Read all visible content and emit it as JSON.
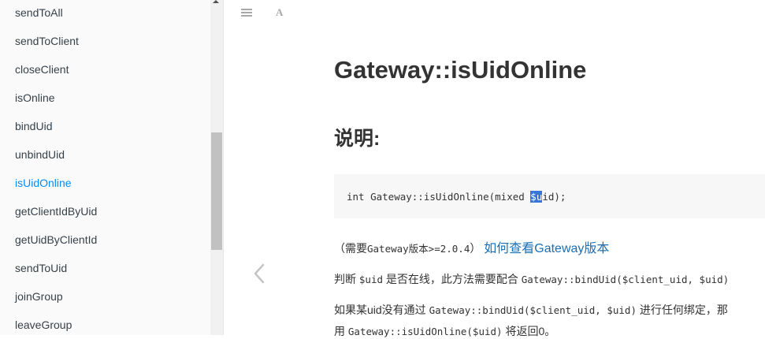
{
  "sidebar": {
    "items": [
      {
        "label": "sendToAll",
        "active": false
      },
      {
        "label": "sendToClient",
        "active": false
      },
      {
        "label": "closeClient",
        "active": false
      },
      {
        "label": "isOnline",
        "active": false
      },
      {
        "label": "bindUid",
        "active": false
      },
      {
        "label": "unbindUid",
        "active": false
      },
      {
        "label": "isUidOnline",
        "active": true
      },
      {
        "label": "getClientIdByUid",
        "active": false
      },
      {
        "label": "getUidByClientId",
        "active": false
      },
      {
        "label": "sendToUid",
        "active": false
      },
      {
        "label": "joinGroup",
        "active": false
      },
      {
        "label": "leaveGroup",
        "active": false
      }
    ]
  },
  "toolbar": {
    "menu_icon": "menu-icon",
    "font_icon": "font-settings-icon",
    "font_glyph": "A"
  },
  "nav": {
    "prev_icon": "chevron-left-icon"
  },
  "page": {
    "title": "Gateway::isUidOnline",
    "section_heading": "说明:",
    "code": {
      "before": "int Gateway::isUidOnline(mixed ",
      "selected": "$u",
      "after": "id);"
    },
    "version": {
      "prefix": "（需要",
      "code": "Gateway版本>=2.0.4",
      "suffix": "）",
      "link": "如何查看Gateway版本"
    },
    "para1": {
      "t1": "判断 ",
      "c1": "$uid",
      "t2": " 是否在线，此方法需要配合 ",
      "c2": "Gateway::bindUid($client_uid, $uid)"
    },
    "para2": {
      "t1": "如果某uid没有通过 ",
      "c1": "Gateway::bindUid($client_uid, $uid)",
      "t2": " 进行任何绑定，那"
    },
    "para3": {
      "t1": "用 ",
      "c1": "Gateway::isUidOnline($uid)",
      "t2": " 将返回0。"
    }
  },
  "colors": {
    "active_link": "#008cff",
    "link": "#1a6fb3",
    "selection": "#3875d7"
  }
}
